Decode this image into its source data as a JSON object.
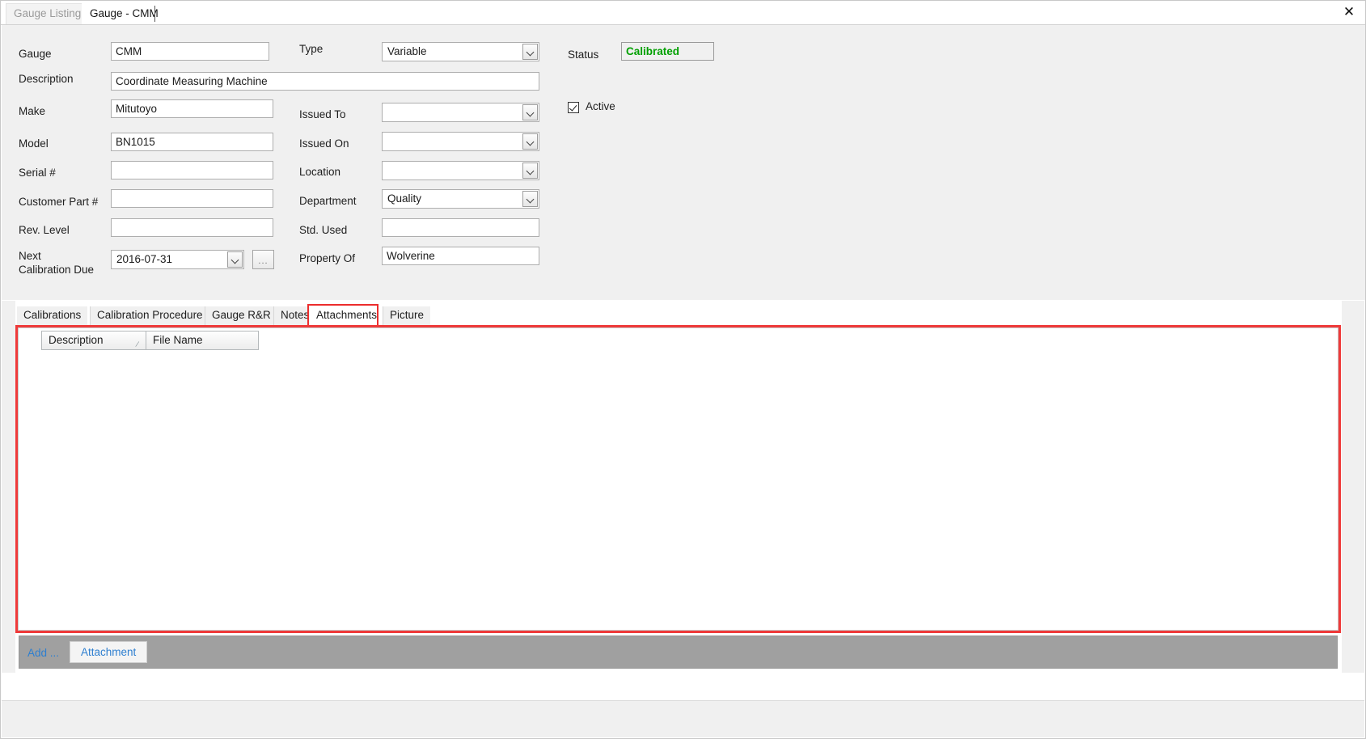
{
  "window": {
    "close_label": "✕"
  },
  "doc_tabs": [
    {
      "label": "Gauge Listing",
      "active": false
    },
    {
      "label": "Gauge - CMM",
      "active": true
    }
  ],
  "form": {
    "left_column": [
      {
        "label": "Gauge",
        "value": "CMM"
      },
      {
        "label": "Description",
        "value": "Coordinate Measuring Machine"
      },
      {
        "label": "Make",
        "value": "Mitutoyo"
      },
      {
        "label": "Model",
        "value": "BN1015"
      },
      {
        "label": "Serial #",
        "value": ""
      },
      {
        "label": "Customer Part #",
        "value": ""
      },
      {
        "label": "Rev. Level",
        "value": ""
      }
    ],
    "next_calibration": {
      "label_line1": "Next",
      "label_line2": "Calibration Due",
      "value": "2016-07-31",
      "ellipsis_label": "..."
    },
    "middle_column": [
      {
        "label": "Type",
        "value": "Variable",
        "kind": "combo"
      },
      {
        "label": "Issued To",
        "value": "",
        "kind": "combo"
      },
      {
        "label": "Issued On",
        "value": "",
        "kind": "combo"
      },
      {
        "label": "Location",
        "value": "",
        "kind": "combo"
      },
      {
        "label": "Department",
        "value": "Quality",
        "kind": "combo"
      },
      {
        "label": "Std. Used",
        "value": "",
        "kind": "text"
      },
      {
        "label": "Property Of",
        "value": "Wolverine",
        "kind": "text"
      }
    ],
    "status": {
      "label": "Status",
      "value": "Calibrated",
      "color": "#00a000"
    },
    "active": {
      "label": "Active",
      "checked": true
    }
  },
  "sub_tabs": [
    {
      "label": "Calibrations",
      "selected": false
    },
    {
      "label": "Calibration Procedure",
      "selected": false
    },
    {
      "label": "Gauge R&R",
      "selected": false
    },
    {
      "label": "Notes",
      "selected": false
    },
    {
      "label": "Attachments",
      "selected": true
    },
    {
      "label": "Picture",
      "selected": false
    }
  ],
  "grid": {
    "columns": [
      {
        "label": "Description",
        "sorted": true,
        "sort_glyph": "⁄"
      },
      {
        "label": "File Name",
        "sorted": false,
        "sort_glyph": ""
      }
    ],
    "rows": []
  },
  "bottom_toolbar": {
    "add_label": "Add ...",
    "attachment_button_label": "Attachment"
  },
  "highlight_color": "#ef3a3a"
}
